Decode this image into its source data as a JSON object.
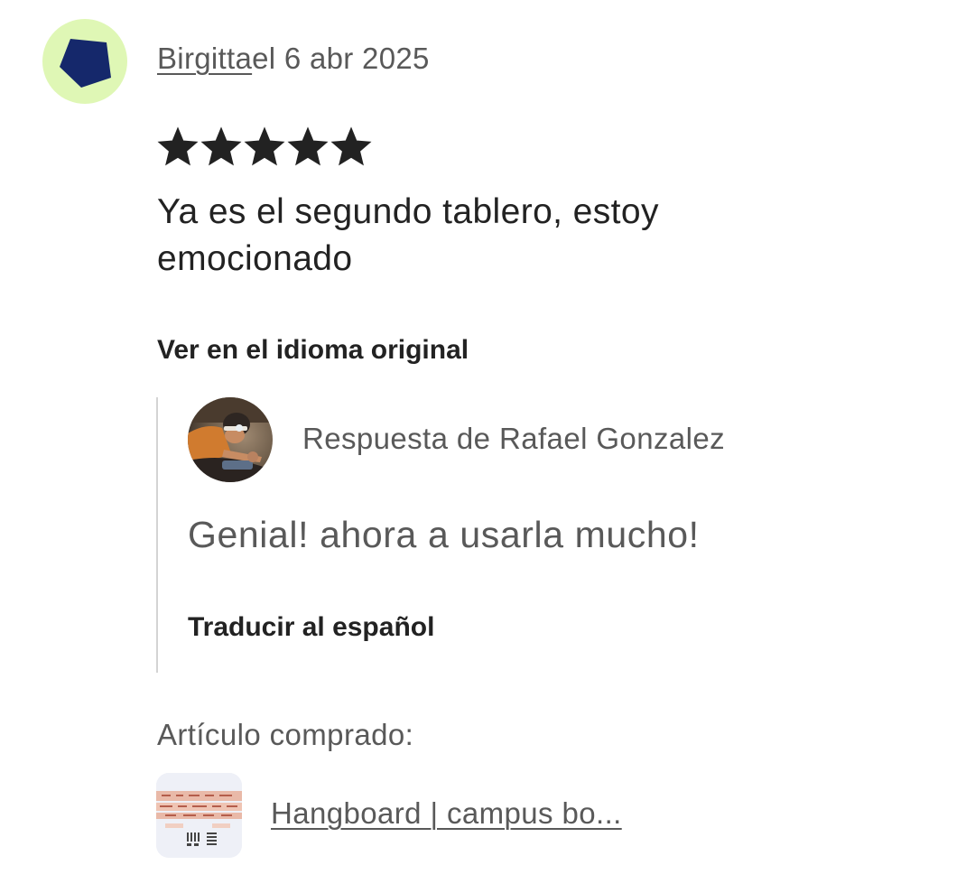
{
  "review": {
    "author": "Birgitta",
    "date_text": "el 6 abr 2025",
    "rating": 5,
    "rating_max": 5,
    "text": "Ya es el segundo tablero, estoy emocionado",
    "view_original_label": "Ver en el idioma original"
  },
  "reply": {
    "author_line": "Respuesta de Rafael Gonzalez",
    "text": "Genial! ahora a usarla mucho!",
    "translate_label": "Traducir al español"
  },
  "purchased": {
    "label": "Artículo comprado:",
    "product_title": "Hangboard | campus bo..."
  },
  "colors": {
    "avatar_background": "#dff7b5",
    "avatar_shape": "#15286b",
    "star": "#222222",
    "primary_text": "#222222",
    "secondary_text": "#595959",
    "reply_border": "#d4d4d4"
  },
  "icons": {
    "reviewer_avatar": "pentagon-avatar-icon",
    "star": "star-icon",
    "reply_avatar": "seller-photo-avatar",
    "product": "hangboard-thumbnail"
  }
}
